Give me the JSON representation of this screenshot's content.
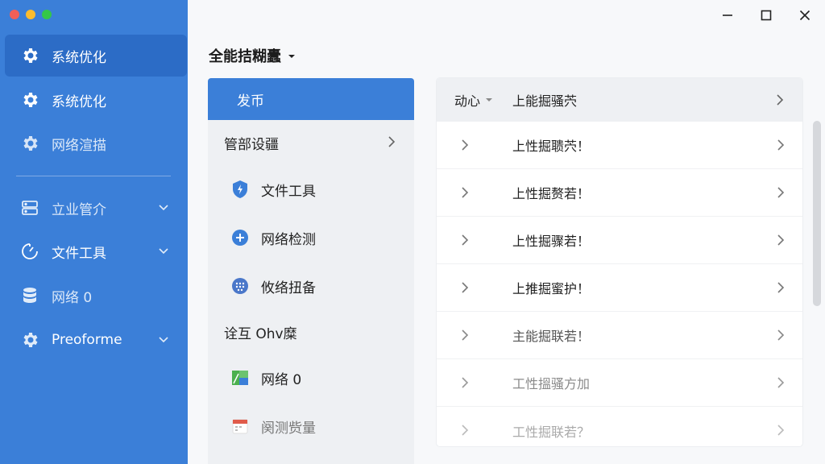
{
  "window": {
    "minimize_glyph": "—",
    "maximize_glyph": "☐",
    "close_glyph": "✕"
  },
  "sidebar": {
    "items": [
      {
        "label": "系统优化",
        "icon": "gear-icon",
        "active": true
      },
      {
        "label": "系统优化",
        "icon": "gear-icon",
        "active": false
      },
      {
        "label": "网络渲描",
        "icon": "gear-icon",
        "active": false
      },
      {
        "label": "立业管介",
        "icon": "server-icon",
        "expandable": true
      },
      {
        "label": "文件工具",
        "icon": "gauge-icon",
        "expandable": true
      },
      {
        "label": "网络 0",
        "icon": "database-icon",
        "expandable": false
      },
      {
        "label": "Preoforme",
        "icon": "gear-icon",
        "expandable": true
      }
    ]
  },
  "main": {
    "title": "全能拮糊蠹"
  },
  "middle": {
    "header": "发币",
    "section1": "管部设疆",
    "items1": [
      {
        "label": "文件工具",
        "icon": "shield-bolt-icon"
      },
      {
        "label": "网络检测",
        "icon": "plus-circle-icon"
      },
      {
        "label": "攸络扭备",
        "icon": "grid-dots-icon"
      }
    ],
    "section2": "诠互 Ohv糜",
    "items2": [
      {
        "label": "网络 0",
        "icon": "app-tile-icon"
      },
      {
        "label": "阕测赀量",
        "icon": "calendar-icon"
      }
    ]
  },
  "right": {
    "header_left": "动心",
    "header_text": "上能掘骚茓",
    "rows": [
      "上性掘聩茓！",
      "上性掘赘若！",
      "上性掘骤若！",
      "上推掘蜜护！",
      "主能掘联若！",
      "工性搵骚方加",
      "工性掘联若？"
    ]
  },
  "colors": {
    "sidebar": "#3b7fd8",
    "sidebar_active": "#2c6cc6",
    "accent": "#3b7fd8"
  }
}
